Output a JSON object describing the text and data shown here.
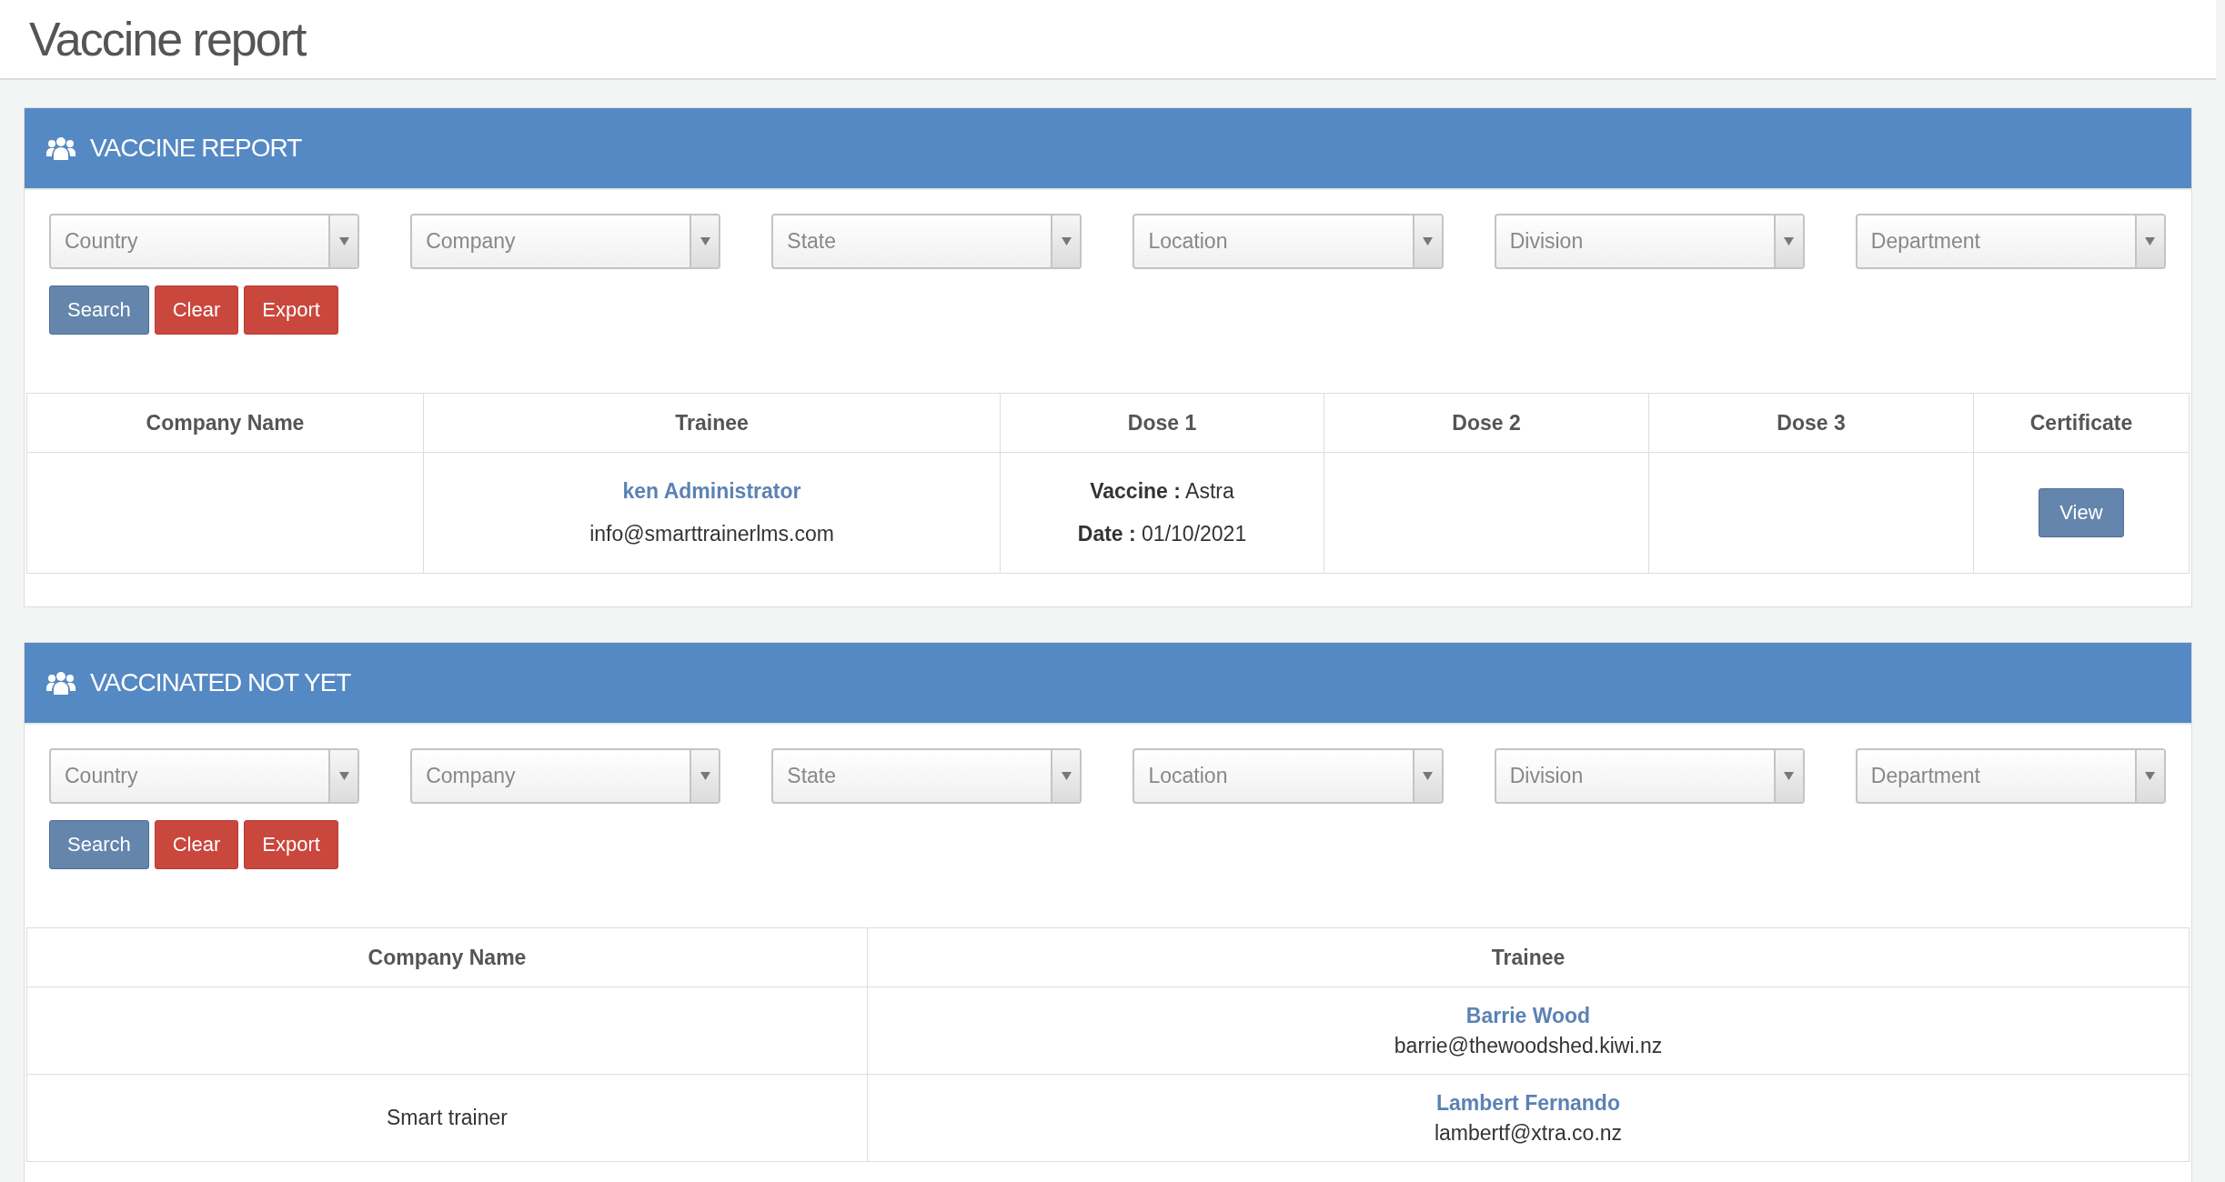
{
  "page": {
    "title": "Vaccine report"
  },
  "sections": [
    {
      "title": "VACCINE REPORT",
      "filters": [
        {
          "placeholder": "Country"
        },
        {
          "placeholder": "Company"
        },
        {
          "placeholder": "State"
        },
        {
          "placeholder": "Location"
        },
        {
          "placeholder": "Division"
        },
        {
          "placeholder": "Department"
        }
      ],
      "buttons": [
        {
          "label": "Search",
          "kind": "primary"
        },
        {
          "label": "Clear",
          "kind": "danger"
        },
        {
          "label": "Export",
          "kind": "danger"
        }
      ],
      "table": {
        "columns": [
          "Company Name",
          "Trainee",
          "Dose 1",
          "Dose 2",
          "Dose 3",
          "Certificate"
        ],
        "rows": [
          {
            "cells": [
              {
                "kind": "empty"
              },
              {
                "kind": "trainee",
                "name": "ken Administrator",
                "email": "info@smarttrainerlms.com"
              },
              {
                "kind": "dose",
                "lines": [
                  "**Vaccine :** Astra",
                  "**Date :** 01/10/2021"
                ]
              },
              {
                "kind": "empty"
              },
              {
                "kind": "empty"
              },
              {
                "kind": "button",
                "label": "View"
              }
            ]
          }
        ]
      }
    },
    {
      "title": "VACCINATED NOT YET",
      "filters": [
        {
          "placeholder": "Country"
        },
        {
          "placeholder": "Company"
        },
        {
          "placeholder": "State"
        },
        {
          "placeholder": "Location"
        },
        {
          "placeholder": "Division"
        },
        {
          "placeholder": "Department"
        }
      ],
      "buttons": [
        {
          "label": "Search",
          "kind": "primary"
        },
        {
          "label": "Clear",
          "kind": "danger"
        },
        {
          "label": "Export",
          "kind": "danger"
        }
      ],
      "table": {
        "columns": [
          "Company Name",
          "Trainee"
        ],
        "rows": [
          {
            "cells": [
              {
                "kind": "empty"
              },
              {
                "kind": "trainee",
                "name": "Barrie Wood",
                "email": "barrie@thewoodshed.kiwi.nz"
              }
            ]
          },
          {
            "cells": [
              {
                "kind": "text",
                "text": "Smart trainer"
              },
              {
                "kind": "trainee",
                "name": "Lambert Fernando",
                "email": "lambertf@xtra.co.nz"
              }
            ]
          }
        ]
      }
    }
  ]
}
